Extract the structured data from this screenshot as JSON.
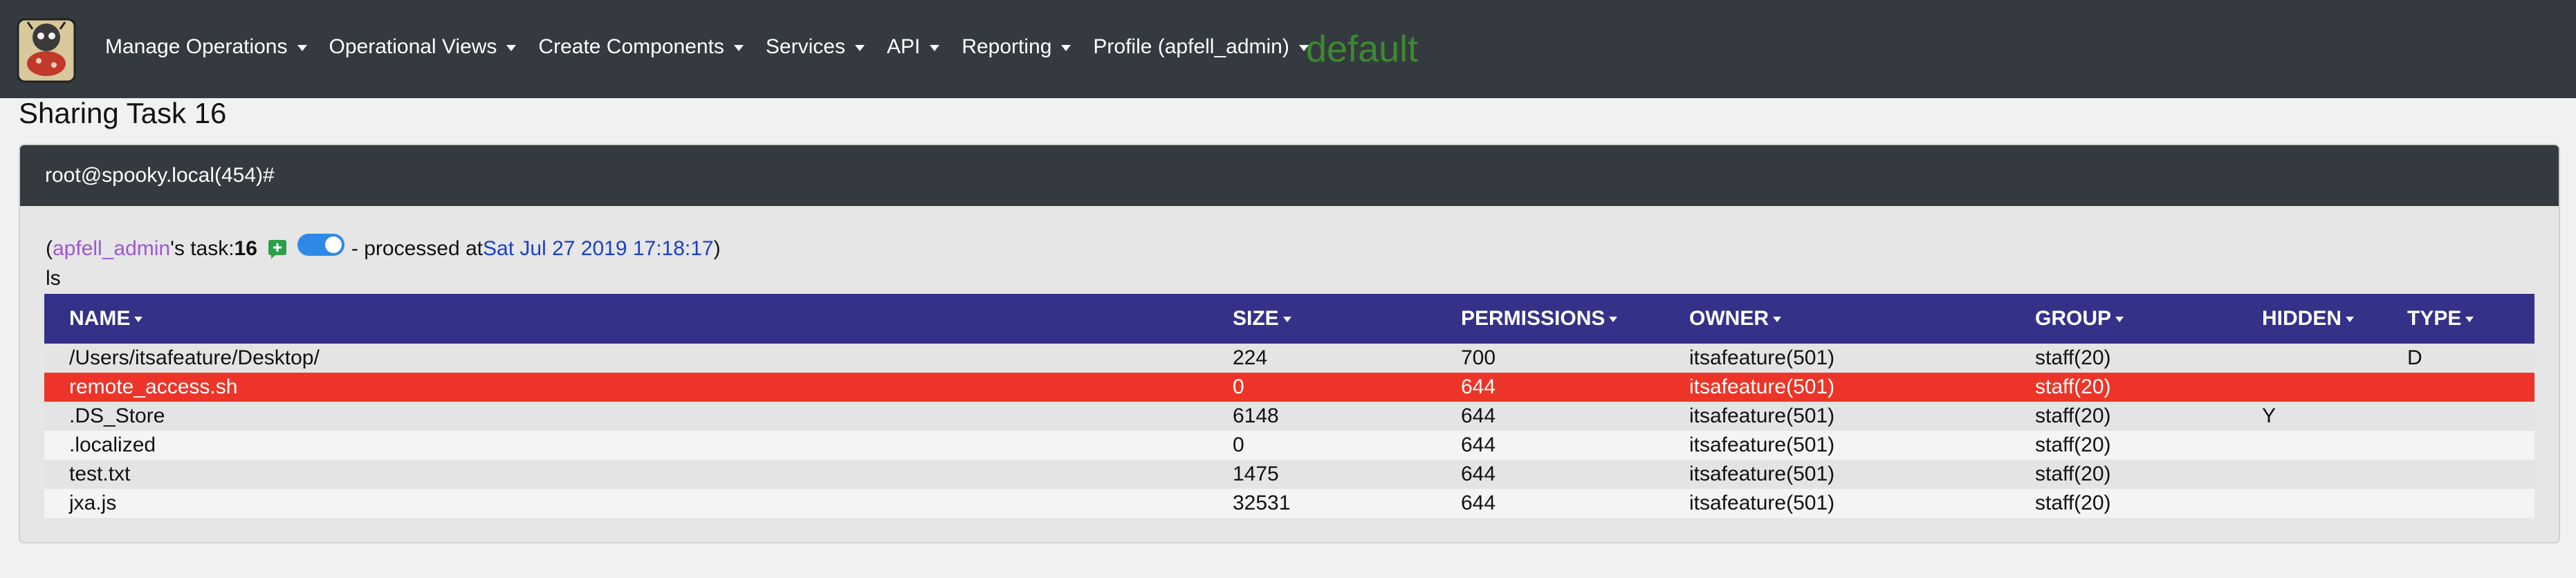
{
  "nav": {
    "items": [
      {
        "label": "Manage Operations",
        "name": "nav-manage-operations"
      },
      {
        "label": "Operational Views",
        "name": "nav-operational-views"
      },
      {
        "label": "Create Components",
        "name": "nav-create-components"
      },
      {
        "label": "Services",
        "name": "nav-services"
      },
      {
        "label": "API",
        "name": "nav-api"
      },
      {
        "label": "Reporting",
        "name": "nav-reporting"
      },
      {
        "label": "Profile (apfell_admin)",
        "name": "nav-profile"
      }
    ],
    "operation_name": "default",
    "logo_icon": "apfell-logo-icon"
  },
  "page": {
    "title": "Sharing Task 16"
  },
  "card": {
    "header": "root@spooky.local(454)#",
    "task": {
      "open_paren": "(",
      "operator": "apfell_admin",
      "task_label": "'s task: ",
      "task_number": "16",
      "processed_text": " - processed at ",
      "timestamp": "Sat Jul 27 2019 17:18:17",
      "close_paren": ")",
      "comment_icon": "add-comment-icon",
      "toggle_on": true
    },
    "command": "ls"
  },
  "colors": {
    "navbar": "#343a40",
    "table_header": "#343189",
    "flagged_row": "#ec3528",
    "operation_name": "#3c8a2e",
    "operator_link": "#9b59d0",
    "timestamp_link": "#1a3fcc",
    "toggle": "#2e8ae6"
  },
  "table": {
    "columns": [
      "NAME",
      "SIZE",
      "PERMISSIONS",
      "OWNER",
      "GROUP",
      "HIDDEN",
      "TYPE"
    ],
    "rows": [
      {
        "name": "/Users/itsafeature/Desktop/",
        "size": "224",
        "permissions": "700",
        "owner": "itsafeature(501)",
        "group": "staff(20)",
        "hidden": "",
        "type": "D",
        "flagged": false
      },
      {
        "name": "remote_access.sh",
        "size": "0",
        "permissions": "644",
        "owner": "itsafeature(501)",
        "group": "staff(20)",
        "hidden": "",
        "type": "",
        "flagged": true
      },
      {
        "name": ".DS_Store",
        "size": "6148",
        "permissions": "644",
        "owner": "itsafeature(501)",
        "group": "staff(20)",
        "hidden": "Y",
        "type": "",
        "flagged": false
      },
      {
        "name": ".localized",
        "size": "0",
        "permissions": "644",
        "owner": "itsafeature(501)",
        "group": "staff(20)",
        "hidden": "",
        "type": "",
        "flagged": false
      },
      {
        "name": "test.txt",
        "size": "1475",
        "permissions": "644",
        "owner": "itsafeature(501)",
        "group": "staff(20)",
        "hidden": "",
        "type": "",
        "flagged": false
      },
      {
        "name": "jxa.js",
        "size": "32531",
        "permissions": "644",
        "owner": "itsafeature(501)",
        "group": "staff(20)",
        "hidden": "",
        "type": "",
        "flagged": false
      }
    ]
  }
}
